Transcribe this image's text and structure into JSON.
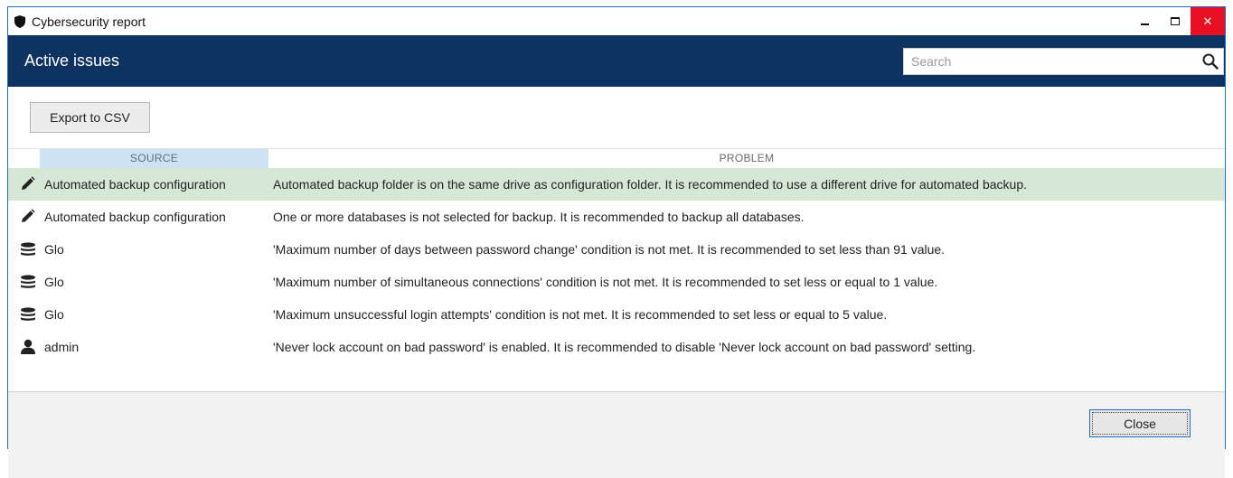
{
  "window": {
    "title": "Cybersecurity report",
    "title_icon": "shield-icon",
    "controls": [
      "minimize-icon",
      "maximize-icon",
      "close-icon"
    ],
    "close_glyph": "✕"
  },
  "header": {
    "title": "Active issues",
    "search_placeholder": "Search",
    "search_value": ""
  },
  "toolbar": {
    "export_label": "Export to CSV"
  },
  "table": {
    "columns": {
      "source": "SOURCE",
      "problem": "PROBLEM"
    },
    "rows": [
      {
        "icon": "pencil-icon",
        "source": "Automated backup configuration",
        "problem": "Automated backup folder is on the same drive as configuration folder. It is recommended to use a different drive for automated backup.",
        "selected": true
      },
      {
        "icon": "pencil-icon",
        "source": "Automated backup configuration",
        "problem": "One or more databases is not selected for backup. It is recommended to backup all databases.",
        "selected": false
      },
      {
        "icon": "database-icon",
        "source": "Glo",
        "problem": "'Maximum number of days between password change' condition is not met. It is recommended to set less than 91 value.",
        "selected": false
      },
      {
        "icon": "database-icon",
        "source": "Glo",
        "problem": "'Maximum number of simultaneous connections' condition is not met. It is recommended to set less or equal to 1 value.",
        "selected": false
      },
      {
        "icon": "database-icon",
        "source": "Glo",
        "problem": "'Maximum unsuccessful login attempts' condition is not met. It is recommended to set less or equal to 5 value.",
        "selected": false
      },
      {
        "icon": "user-icon",
        "source": "admin",
        "problem": "'Never lock account on bad password' is enabled. It is recommended to disable 'Never lock account on bad password' setting.",
        "selected": false
      }
    ]
  },
  "footer": {
    "close_label": "Close"
  },
  "colors": {
    "header_bg": "#0f3360",
    "selected_row": "#d6e7d6",
    "source_header": "#cde3f3",
    "window_border": "#1e6fc4",
    "close_btn_red": "#e81123"
  }
}
